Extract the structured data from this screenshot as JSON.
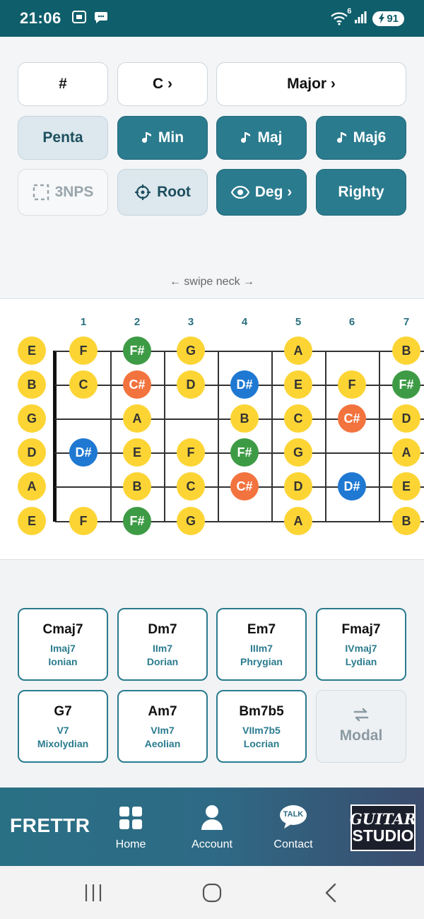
{
  "status_bar": {
    "time": "21:06",
    "battery": "91",
    "wifi_badge": "6",
    "icons": [
      "screenshot-icon",
      "chat-bubble-icon",
      "wifi-icon",
      "signal-icon",
      "battery-icon"
    ]
  },
  "controls": {
    "sharp": "#",
    "key": "C ›",
    "scale": "Major ›",
    "penta": "Penta",
    "min": "Min",
    "maj": "Maj",
    "maj6": "Maj6",
    "nps": "3NPS",
    "root": "Root",
    "deg": "Deg ›",
    "righty": "Righty",
    "swipe_hint": "← swipe neck →"
  },
  "fretboard": {
    "fret_numbers": [
      "1",
      "2",
      "3",
      "4",
      "5",
      "6",
      "7"
    ],
    "open_strings": [
      "E",
      "B",
      "G",
      "D",
      "A",
      "E"
    ],
    "notes": [
      [
        "F",
        "F#",
        "G",
        "",
        "A",
        "",
        "B"
      ],
      [
        "C",
        "C#",
        "D",
        "D#",
        "E",
        "F",
        "F#"
      ],
      [
        "",
        "A",
        "",
        "B",
        "C",
        "C#",
        "D"
      ],
      [
        "D#",
        "E",
        "F",
        "F#",
        "G",
        "",
        "A"
      ],
      [
        "",
        "B",
        "C",
        "C#",
        "D",
        "D#",
        "E"
      ],
      [
        "F",
        "F#",
        "G",
        "",
        "A",
        "",
        "B"
      ]
    ],
    "colors": {
      "natural": "#fcd535",
      "F#": "#3e9b45",
      "C#": "#f2733e",
      "D#": "#1f78d1"
    }
  },
  "chords": [
    {
      "name": "Cmaj7",
      "degree": "Imaj7",
      "mode": "Ionian"
    },
    {
      "name": "Dm7",
      "degree": "IIm7",
      "mode": "Dorian"
    },
    {
      "name": "Em7",
      "degree": "IIIm7",
      "mode": "Phrygian"
    },
    {
      "name": "Fmaj7",
      "degree": "IVmaj7",
      "mode": "Lydian"
    },
    {
      "name": "G7",
      "degree": "V7",
      "mode": "Mixolydian"
    },
    {
      "name": "Am7",
      "degree": "VIm7",
      "mode": "Aeolian"
    },
    {
      "name": "Bm7b5",
      "degree": "VIIm7b5",
      "mode": "Locrian"
    }
  ],
  "modal_button": "Modal",
  "bottom_nav": {
    "brand": "FRETTR",
    "items": [
      {
        "label": "Home",
        "icon": "grid-icon"
      },
      {
        "label": "Account",
        "icon": "user-icon"
      },
      {
        "label": "Contact",
        "icon": "talk-bubble-icon",
        "icon_text": "TALK"
      }
    ],
    "logo_line1": "GUITAR",
    "logo_line2": "STUDIO"
  },
  "system_nav": [
    "recents-icon",
    "home-circle-icon",
    "back-icon"
  ],
  "theme": {
    "primary": "#2a7b8e",
    "status_bar": "#0f5e6b"
  }
}
